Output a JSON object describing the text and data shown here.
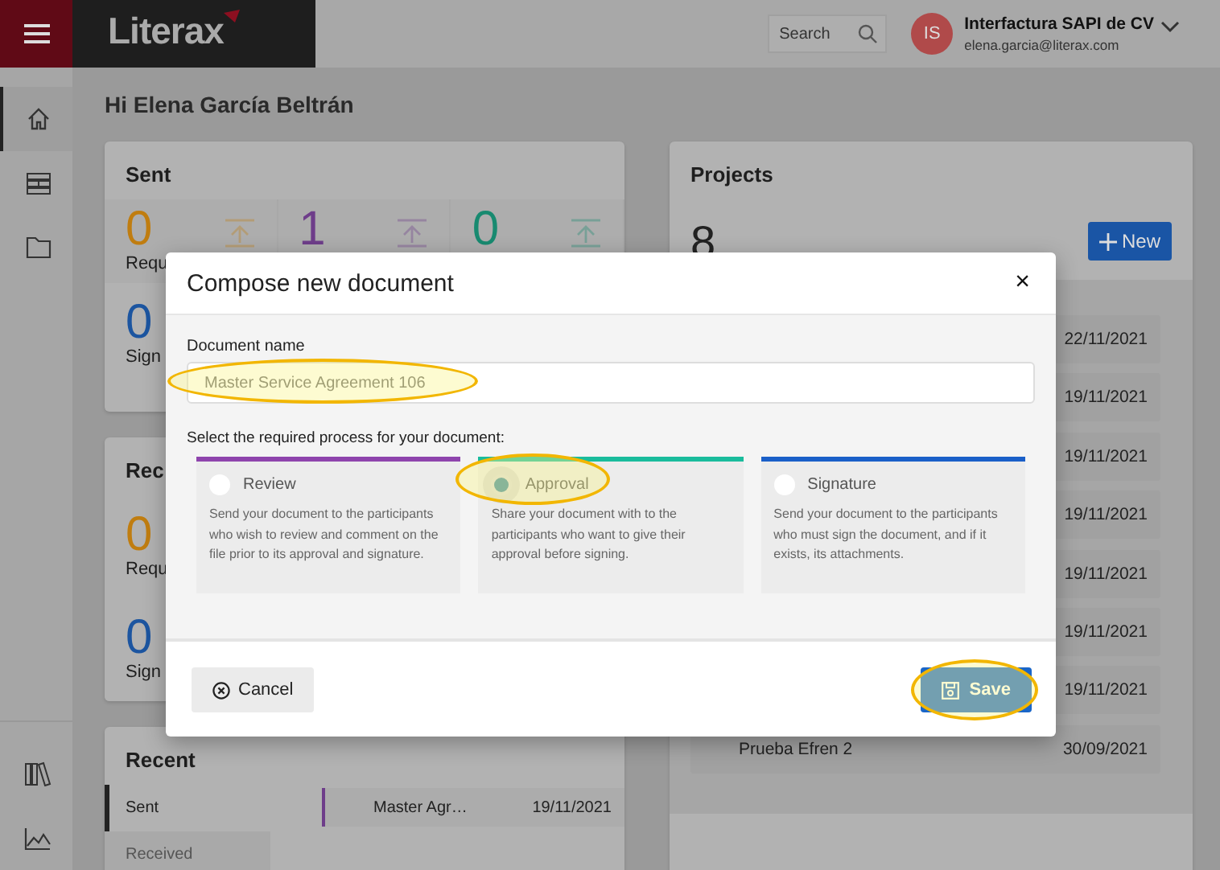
{
  "top_bar": {
    "logo": "Literax",
    "search": {
      "placeholder": "Search"
    },
    "account": {
      "initials": "IS",
      "company": "Interfactura SAPI de CV",
      "email": "elena.garcia@literax.com"
    }
  },
  "sidebar": {
    "items": [
      {
        "kind": "home",
        "selected": true
      },
      {
        "kind": "table",
        "selected": false
      },
      {
        "kind": "folder",
        "selected": false
      }
    ],
    "bottom_items": [
      {
        "kind": "books"
      },
      {
        "kind": "chart"
      }
    ]
  },
  "greeting": "Hi Elena García Beltrán",
  "sent": {
    "title": "Sent",
    "stats": [
      {
        "value": "0",
        "label": "Requ",
        "color": "#c07d10"
      },
      {
        "value": "1",
        "color": "#6e3d8a"
      },
      {
        "value": "0",
        "color": "#188a70"
      },
      {
        "value": "0",
        "label": "Sign",
        "color": "#1c55a0"
      }
    ]
  },
  "received": {
    "title": "Rec",
    "stats": [
      {
        "value": "0",
        "label": "Requ",
        "color": "#c07d10"
      },
      {
        "value": "0",
        "label": "Sign",
        "color": "#1c55a0"
      }
    ]
  },
  "recent": {
    "title": "Recent",
    "tabs": [
      {
        "label": "Sent",
        "selected": true
      },
      {
        "label": "Received",
        "selected": false
      }
    ],
    "rows": [
      {
        "name": "Master Agr…",
        "date": "19/11/2021",
        "color": "#6e3d8a"
      }
    ]
  },
  "projects": {
    "title": "Projects",
    "count": "8",
    "new_button": "New",
    "rows": [
      {
        "date": "22/11/2021"
      },
      {
        "date": "19/11/2021"
      },
      {
        "date": "19/11/2021"
      },
      {
        "date": "19/11/2021"
      },
      {
        "date": "19/11/2021"
      },
      {
        "date": "19/11/2021"
      },
      {
        "date": "19/11/2021"
      },
      {
        "name": "Prueba Efren 2",
        "date": "30/09/2021"
      }
    ]
  },
  "modal": {
    "title": "Compose new document",
    "close": "×",
    "name_field": {
      "label": "Document name",
      "value": "Master Service Agreement 106",
      "highlighted": true
    },
    "process_prompt": "Select the required process for your document:",
    "processes": [
      {
        "title": "Review",
        "description": "Send your document to the participants who wish to review and comment on the file prior to its approval and signature.",
        "color": "#8e44ad",
        "selected": false,
        "highlighted": false
      },
      {
        "title": "Approval",
        "description": "Share your document with to the participants who want to give their approval before signing.",
        "color": "#1abc9c",
        "selected": true,
        "highlighted": true
      },
      {
        "title": "Signature",
        "description": "Send your document to the participants who must sign the document, and if it exists, its attachments.",
        "color": "#1a5fc8",
        "selected": false,
        "highlighted": false
      }
    ],
    "cancel_button": {
      "label": "Cancel"
    },
    "save_button": {
      "label": "Save",
      "highlighted": true
    }
  }
}
